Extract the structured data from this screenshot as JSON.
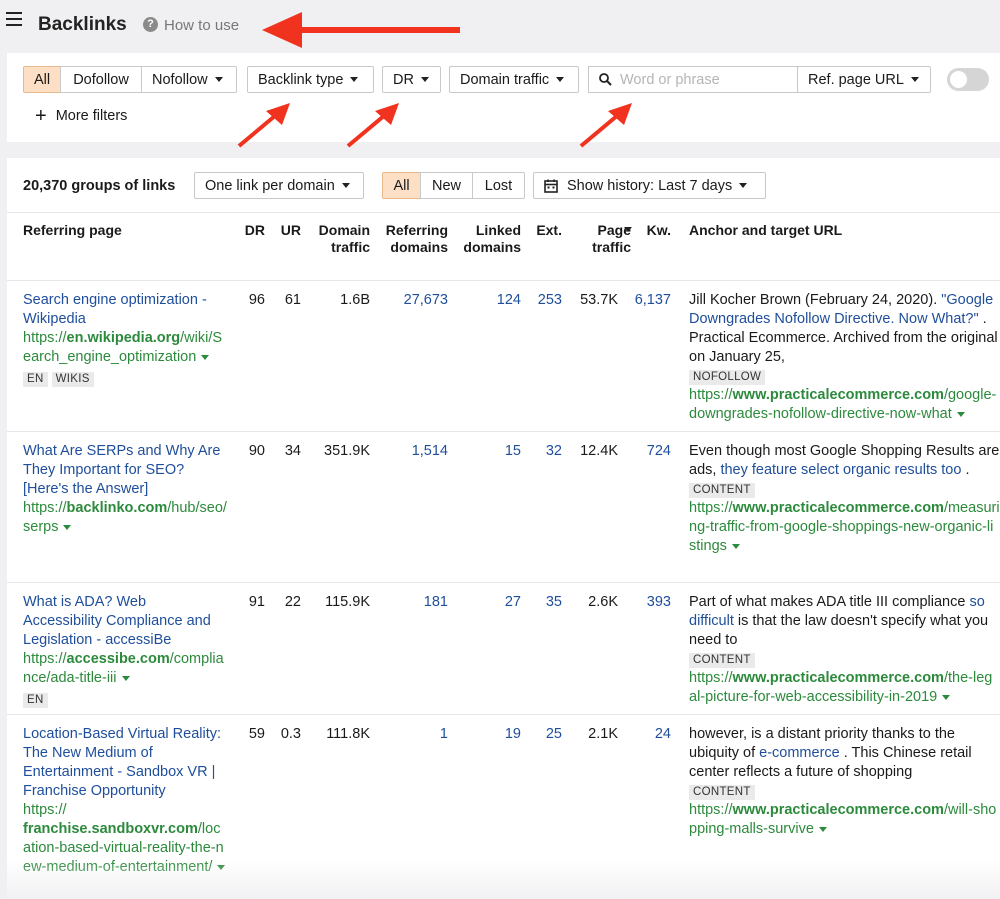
{
  "header": {
    "title": "Backlinks",
    "help_text": "How to use"
  },
  "filters": {
    "link_types": [
      "All",
      "Dofollow",
      "Nofollow"
    ],
    "backlink_type": "Backlink type",
    "dr": "DR",
    "domain_traffic": "Domain traffic",
    "search_placeholder": "Word or phrase",
    "search_value": "",
    "ref_page_url": "Ref. page URL",
    "more_filters": "More filters"
  },
  "results": {
    "count": "20,370 groups of links",
    "grouping": "One link per domain",
    "status_tabs": [
      "All",
      "New",
      "Lost"
    ],
    "history": "Show history: Last 7 days"
  },
  "columns": {
    "referring_page": "Referring page",
    "dr": "DR",
    "ur": "UR",
    "domain_traffic": "Domain traffic",
    "referring_domains": "Referring domains",
    "linked_domains": "Linked domains",
    "ext": "Ext.",
    "page_traffic": "Page traffic",
    "kw": "Kw.",
    "anchor": "Anchor and target URL"
  },
  "rows": [
    {
      "title": "Search engine optimization - Wikipedia",
      "url_prefix": "https://",
      "url_domain": "en.wikipedia.org",
      "url_path": "/wiki/Search_engine_optimization",
      "tags": [
        "EN",
        "WIKIS"
      ],
      "dr": "96",
      "ur": "61",
      "domain_traffic": "1.6B",
      "referring_domains": "27,673",
      "linked_domains": "124",
      "ext": "253",
      "page_traffic": "53.7K",
      "kw": "6,137",
      "anchor_before": "Jill Kocher Brown (February 24, 2020). ",
      "anchor_link": "\"Google Downgrades Nofollow Directive. Now What?\"",
      "anchor_after": " . Practical Ecommerce. Archived from the original on January 25,",
      "anchor_tag": "NOFOLLOW",
      "target_prefix": "https://",
      "target_domain": "www.practicalecommerce.com",
      "target_path": "/google-downgrades-nofollow-directive-now-what"
    },
    {
      "title": "What Are SERPs and Why Are They Important for SEO? [Here's the Answer]",
      "url_prefix": "https://",
      "url_domain": "backlinko.com",
      "url_path": "/hub/seo/serps",
      "tags": [],
      "dr": "90",
      "ur": "34",
      "domain_traffic": "351.9K",
      "referring_domains": "1,514",
      "linked_domains": "15",
      "ext": "32",
      "page_traffic": "12.4K",
      "kw": "724",
      "anchor_before": "Even though most Google Shopping Results are ads, ",
      "anchor_link": "they feature select organic results too",
      "anchor_after": " .",
      "anchor_tag": "CONTENT",
      "target_prefix": "https://",
      "target_domain": "www.practicalecommerce.com",
      "target_path": "/measuring-traffic-from-google-shoppings-new-organic-listings"
    },
    {
      "title": "What is ADA? Web Accessibility Compliance and Legislation - accessiBe",
      "url_prefix": "https://",
      "url_domain": "accessibe.com",
      "url_path": "/compliance/ada-title-iii",
      "tags": [
        "EN"
      ],
      "dr": "91",
      "ur": "22",
      "domain_traffic": "115.9K",
      "referring_domains": "181",
      "linked_domains": "27",
      "ext": "35",
      "page_traffic": "2.6K",
      "kw": "393",
      "anchor_before": "Part of what makes ADA title III compliance ",
      "anchor_link": "so difficult",
      "anchor_after": " is that the law doesn't specify what you need to",
      "anchor_tag": "CONTENT",
      "target_prefix": "https://",
      "target_domain": "www.practicalecommerce.com",
      "target_path": "/the-legal-picture-for-web-accessibility-in-2019"
    },
    {
      "title": "Location-Based Virtual Reality: The New Medium of Entertainment - Sandbox VR | Franchise Opportunity",
      "url_prefix": "https://",
      "url_domain": "franchise.sandboxvr.com",
      "url_path": "/location-based-virtual-reality-the-new-medium-of-entertainment/",
      "tags": [],
      "dr": "59",
      "ur": "0.3",
      "domain_traffic": "111.8K",
      "referring_domains": "1",
      "linked_domains": "19",
      "ext": "25",
      "page_traffic": "2.1K",
      "kw": "24",
      "anchor_before": "however, is a distant priority thanks to the ubiquity of ",
      "anchor_link": "e-commerce",
      "anchor_after": " . This Chinese retail center reflects a future of shopping",
      "anchor_tag": "CONTENT",
      "target_prefix": "https://",
      "target_domain": "www.practicalecommerce.com",
      "target_path": "/will-shopping-malls-survive"
    }
  ],
  "colors": {
    "accent_active": "#fcdfc4",
    "link_blue": "#1f4e9b",
    "url_green": "#2c8a3c",
    "annotation_arrow": "#f0321e"
  }
}
